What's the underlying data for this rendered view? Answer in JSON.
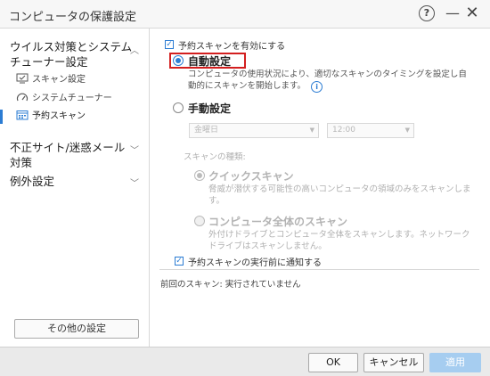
{
  "window": {
    "title": "コンピュータの保護設定",
    "help_label": "?",
    "minimize_label": "—",
    "close_label": "✕"
  },
  "sidebar": {
    "section1": {
      "title_line1": "ウイルス対策とシステム",
      "title_line2": "チューナー設定",
      "chevron": "︿"
    },
    "items": [
      {
        "label": "スキャン設定",
        "icon": "monitor-icon"
      },
      {
        "label": "システムチューナー",
        "icon": "gauge-icon"
      },
      {
        "label": "予約スキャン",
        "icon": "calendar-icon",
        "active": true
      }
    ],
    "section2": {
      "title_line1": "不正サイト/迷惑メール",
      "title_line2": "対策",
      "chevron": "﹀"
    },
    "section3": {
      "title": "例外設定",
      "chevron": "﹀"
    },
    "other_settings_label": "その他の設定"
  },
  "main": {
    "enable_schedule": {
      "label": "予約スキャンを有効にする",
      "checked": true
    },
    "auto": {
      "label": "自動設定",
      "selected": true,
      "desc_line1": "コンピュータの使用状況により、適切なスキャンのタイミングを設定し自",
      "desc_line2": "動的にスキャンを開始します。",
      "info_icon": "i"
    },
    "manual": {
      "label": "手動設定",
      "selected": false,
      "day_select": "金曜日",
      "time_select": "12:00",
      "scan_type_label": "スキャンの種類:",
      "quick": {
        "label": "クイックスキャン",
        "selected": true,
        "desc_line1": "脅威が潜伏する可能性の高いコンピュータの領域のみをスキャンしま",
        "desc_line2": "す。"
      },
      "full": {
        "label": "コンピュータ全体のスキャン",
        "selected": false,
        "desc_line1": "外付けドライブとコンピュータ全体をスキャンします。ネットワーク",
        "desc_line2": "ドライブはスキャンしません。"
      }
    },
    "notify": {
      "label": "予約スキャンの実行前に通知する",
      "checked": true
    },
    "last_scan": "前回のスキャン: 実行されていません"
  },
  "footer": {
    "ok_label": "OK",
    "cancel_label": "キャンセル",
    "apply_label": "適用"
  },
  "colors": {
    "accent": "#2b7cd3",
    "highlight_box": "#d31f1f",
    "apply_disabled": "#a6cdf0"
  }
}
